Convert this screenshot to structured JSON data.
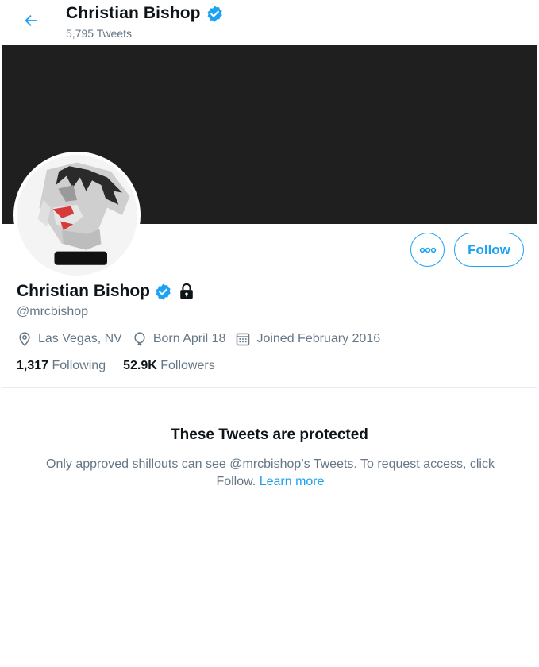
{
  "header": {
    "name": "Christian Bishop",
    "tweet_count": "5,795 Tweets"
  },
  "profile": {
    "name": "Christian Bishop",
    "handle": "@mrcbishop",
    "location": "Las Vegas, NV",
    "birthday": "Born April 18",
    "joined": "Joined February 2016",
    "following_count": "1,317",
    "following_label": "Following",
    "followers_count": "52.9K",
    "followers_label": "Followers"
  },
  "actions": {
    "follow_label": "Follow"
  },
  "protected": {
    "title": "These Tweets are protected",
    "message": "Only approved shillouts can see @mrcbishop’s Tweets. To request access, click Follow.",
    "learn_more": "Learn more"
  },
  "colors": {
    "accent": "#1da1f2",
    "banner": "#1f1f1f",
    "secondary_text": "#657786"
  },
  "icons": [
    "back-arrow-icon",
    "verified-badge-icon",
    "lock-icon",
    "more-icon",
    "location-icon",
    "balloon-icon",
    "calendar-icon"
  ]
}
